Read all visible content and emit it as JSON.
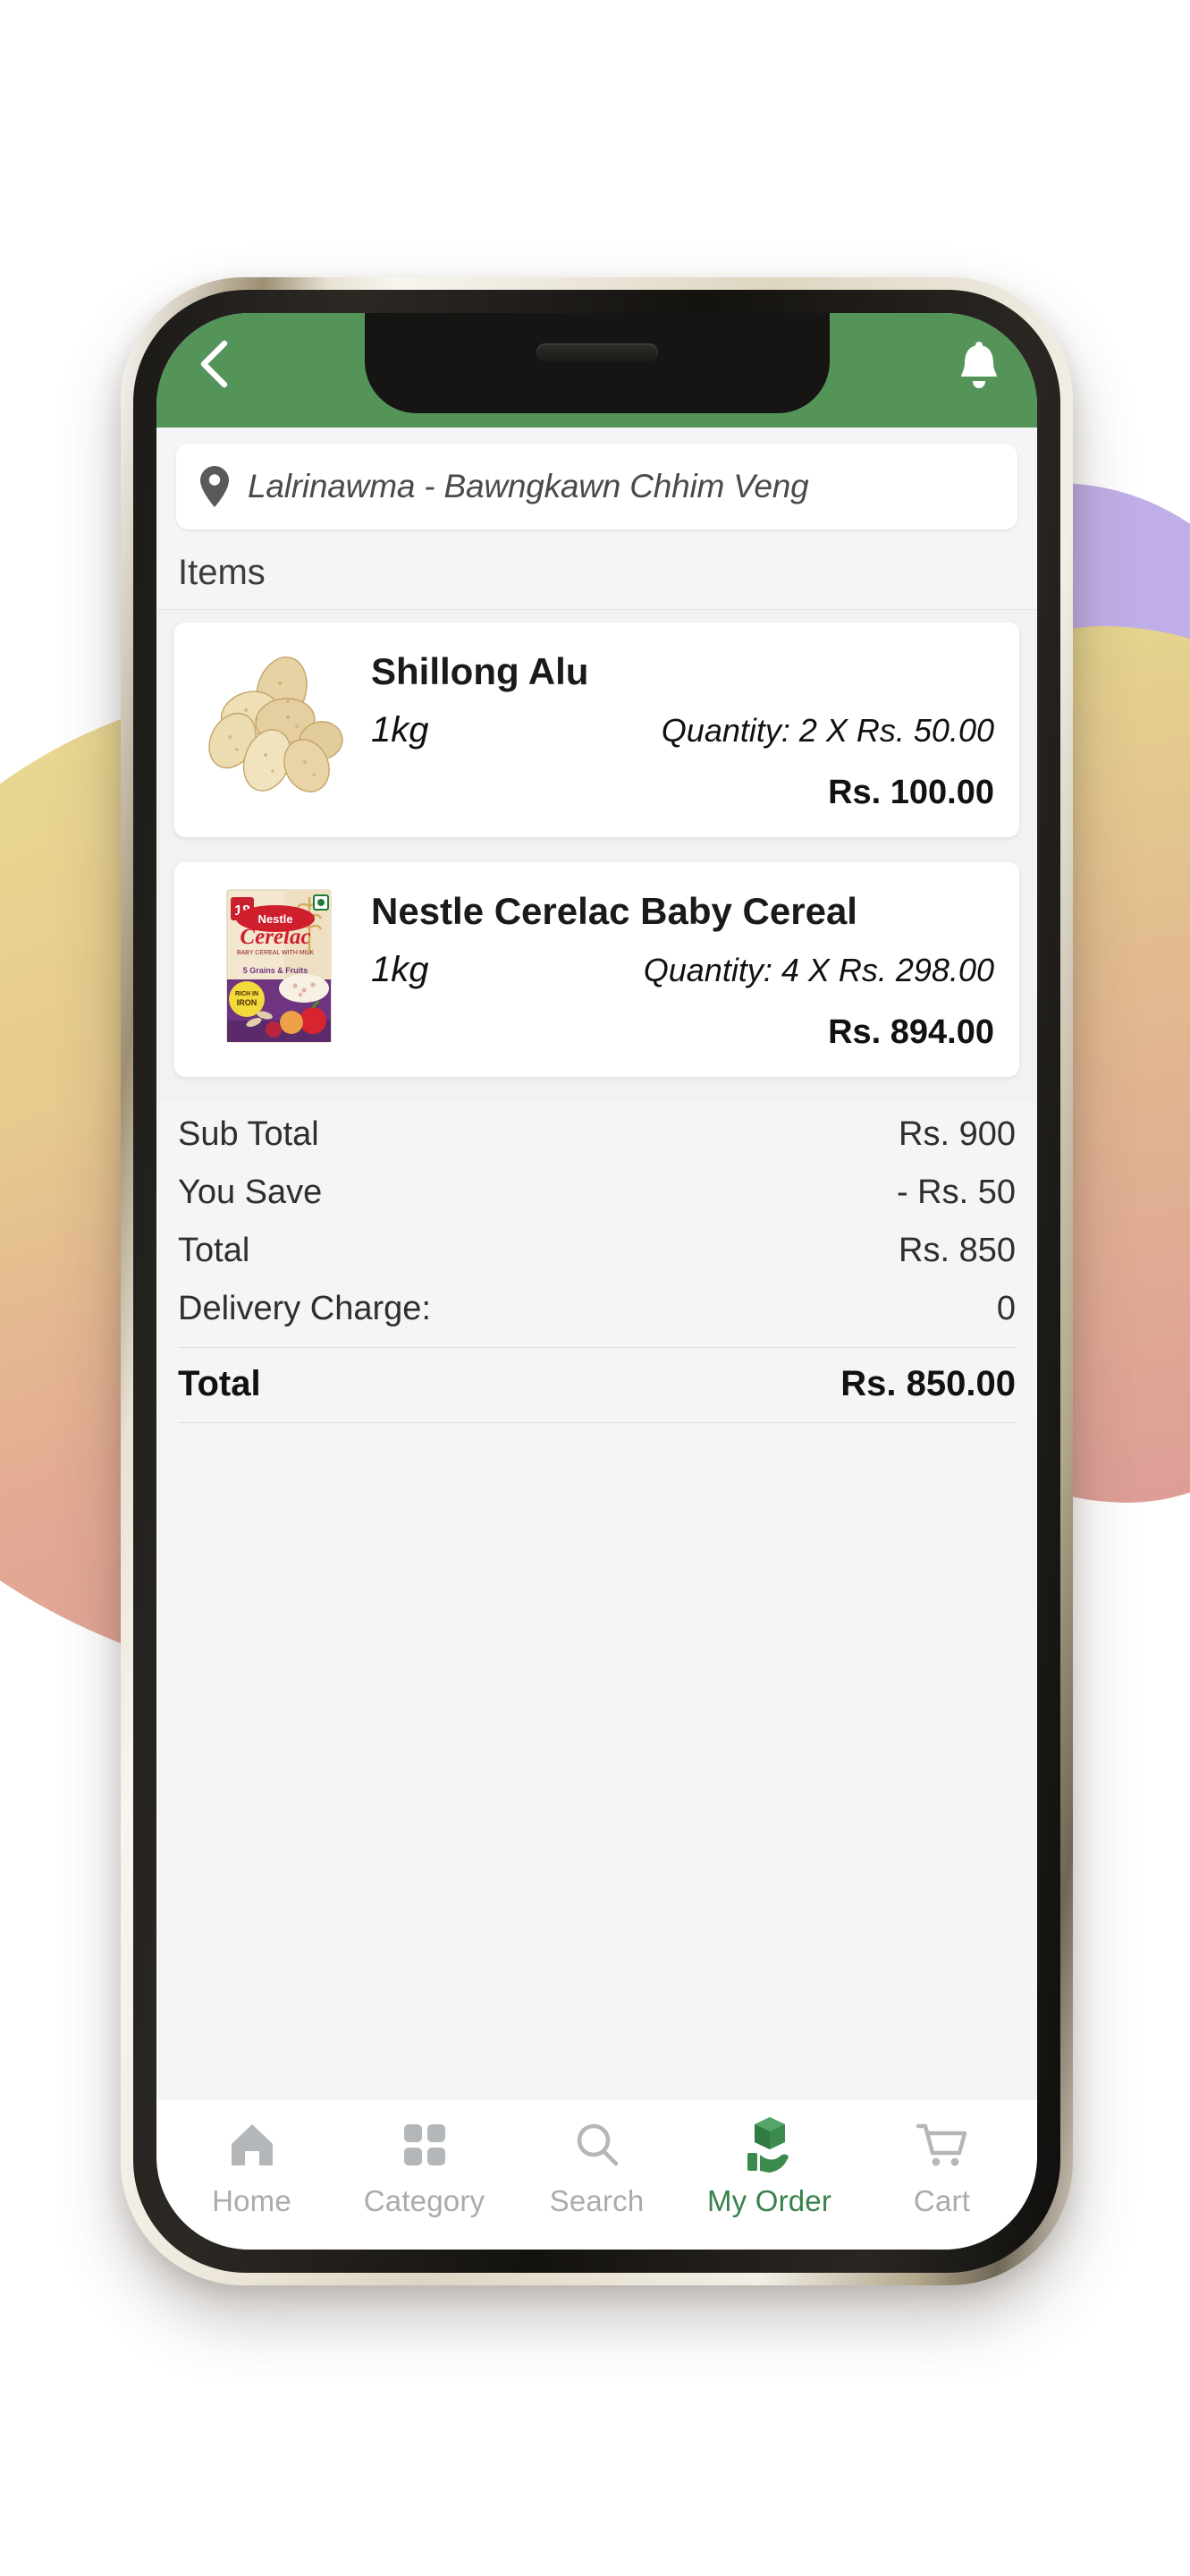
{
  "theme": {
    "header_green": "#549459",
    "accent_green": "#37824a",
    "screen_bg": "#f4f5f6",
    "card_bg": "#ffffff",
    "text_dark": "#111111",
    "text_muted": "#a9acae"
  },
  "header": {
    "back_icon": "chevron-left-icon",
    "bell_icon": "bell-icon"
  },
  "address": {
    "pin_icon": "map-pin-icon",
    "text": "Lalrinawma - Bawngkawn Chhim Veng"
  },
  "sections": {
    "items_label": "Items"
  },
  "items": [
    {
      "name": "Shillong Alu",
      "weight": "1kg",
      "quantity_text": "Quantity: 2 X Rs. 50.00",
      "price": "Rs. 100.00",
      "image_name": "potatoes-image"
    },
    {
      "name": "Nestle Cerelac Baby Cereal",
      "weight": "1kg",
      "quantity_text": "Quantity: 4 X Rs. 298.00",
      "price": "Rs. 894.00",
      "image_name": "cerelac-box-image"
    }
  ],
  "totals": {
    "rows": [
      {
        "label": "Sub Total",
        "value": "Rs. 900"
      },
      {
        "label": "You Save",
        "value": "- Rs. 50"
      },
      {
        "label": "Total",
        "value": "Rs. 850"
      },
      {
        "label": "Delivery Charge:",
        "value": "0"
      }
    ],
    "grand": {
      "label": "Total",
      "value": "Rs. 850.00"
    }
  },
  "bottom_nav": {
    "items": [
      {
        "label": "Home",
        "icon": "home-icon",
        "active": false
      },
      {
        "label": "Category",
        "icon": "grid-icon",
        "active": false
      },
      {
        "label": "Search",
        "icon": "search-icon",
        "active": false
      },
      {
        "label": "My Order",
        "icon": "package-in-hand-icon",
        "active": true
      },
      {
        "label": "Cart",
        "icon": "shopping-cart-icon",
        "active": false
      }
    ]
  }
}
